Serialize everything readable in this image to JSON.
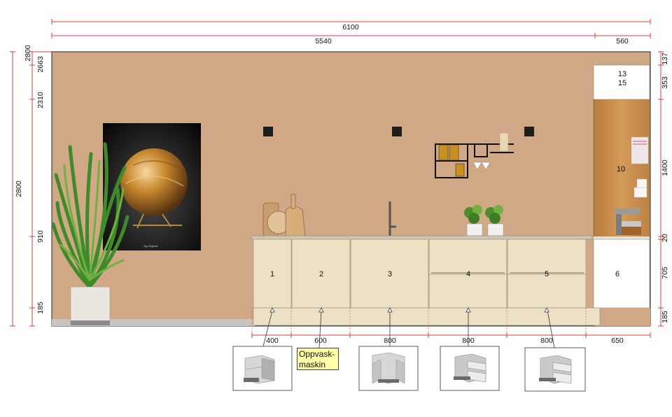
{
  "dimensions": {
    "total_width": "6100",
    "left_width": "5540",
    "right_width": "560",
    "left_vertical": [
      "2800",
      "2663",
      "2310",
      "910",
      "185"
    ],
    "total_height": "2800",
    "right_vertical": [
      "137",
      "353",
      "1400",
      "20",
      "705",
      "185"
    ],
    "bottom": [
      "400",
      "600",
      "800",
      "800",
      "800",
      "650"
    ]
  },
  "cabinets": [
    "1",
    "2",
    "3",
    "4",
    "5",
    "6"
  ],
  "tall_unit_labels": {
    "top_a": "13",
    "top_b": "15",
    "middle": "10"
  },
  "note": {
    "line1": "Oppvask-",
    "line2": "maskin"
  },
  "poster_caption": "Ag Original",
  "colors": {
    "wall": "#d1a886",
    "cabinet_front": "#ede1c5",
    "worktop": "#cfc7b6",
    "oak": "#c98f4c",
    "dimension_line": "#e23b3b",
    "note_bg": "#ffffa8"
  }
}
